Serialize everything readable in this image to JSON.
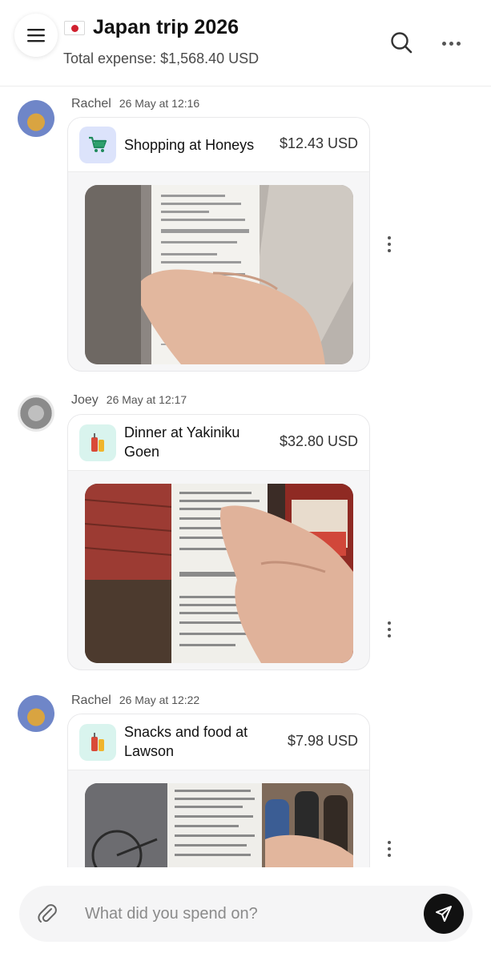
{
  "header": {
    "title": "Japan trip 2026",
    "total_expense": "Total expense: $1,568.40 USD",
    "menu_icon": "hamburger-icon",
    "search_icon": "search-icon",
    "more_icon": "more-horizontal-icon",
    "flag_icon": "japan-flag-icon"
  },
  "messages": [
    {
      "author": "Rachel",
      "time": "26 May at 12:16",
      "title": "Shopping at Honeys",
      "amount": "$12.43 USD",
      "category_icon": "shopping-cart-icon"
    },
    {
      "author": "Joey",
      "time": "26 May at 12:17",
      "title": "Dinner at Yakiniku Goen",
      "amount": "$32.80 USD",
      "category_icon": "food-drink-icon"
    },
    {
      "author": "Rachel",
      "time": "26 May at 12:22",
      "title": "Snacks and food at Lawson",
      "amount": "$7.98 USD",
      "category_icon": "food-drink-icon"
    }
  ],
  "composer": {
    "placeholder": "What did you spend on?",
    "attach_icon": "paperclip-icon",
    "send_icon": "send-icon"
  },
  "colors": {
    "shop_icon_bg": "#dce3fb",
    "food_icon_bg": "#d9f4ee",
    "send_button": "#111111"
  }
}
